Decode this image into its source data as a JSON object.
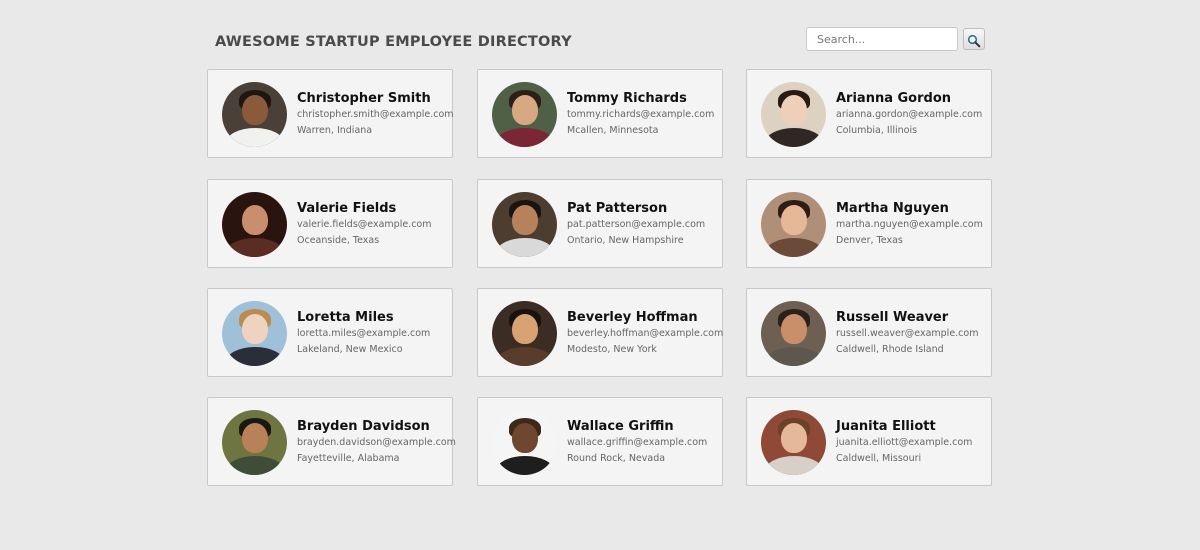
{
  "header": {
    "title": "AWESOME STARTUP EMPLOYEE DIRECTORY",
    "search_placeholder": "Search...",
    "search_icon": "magnifier-icon"
  },
  "employees": [
    {
      "name": "Christopher Smith",
      "email": "christopher.smith@example.com",
      "location": "Warren, Indiana"
    },
    {
      "name": "Tommy Richards",
      "email": "tommy.richards@example.com",
      "location": "Mcallen, Minnesota"
    },
    {
      "name": "Arianna Gordon",
      "email": "arianna.gordon@example.com",
      "location": "Columbia, Illinois"
    },
    {
      "name": "Valerie Fields",
      "email": "valerie.fields@example.com",
      "location": "Oceanside, Texas"
    },
    {
      "name": "Pat Patterson",
      "email": "pat.patterson@example.com",
      "location": "Ontario, New Hampshire"
    },
    {
      "name": "Martha Nguyen",
      "email": "martha.nguyen@example.com",
      "location": "Denver, Texas"
    },
    {
      "name": "Loretta Miles",
      "email": "loretta.miles@example.com",
      "location": "Lakeland, New Mexico"
    },
    {
      "name": "Beverley Hoffman",
      "email": "beverley.hoffman@example.com",
      "location": "Modesto, New York"
    },
    {
      "name": "Russell Weaver",
      "email": "russell.weaver@example.com",
      "location": "Caldwell, Rhode Island"
    },
    {
      "name": "Brayden Davidson",
      "email": "brayden.davidson@example.com",
      "location": "Fayetteville, Alabama"
    },
    {
      "name": "Wallace Griffin",
      "email": "wallace.griffin@example.com",
      "location": "Round Rock, Nevada"
    },
    {
      "name": "Juanita Elliott",
      "email": "juanita.elliott@example.com",
      "location": "Caldwell, Missouri"
    }
  ]
}
